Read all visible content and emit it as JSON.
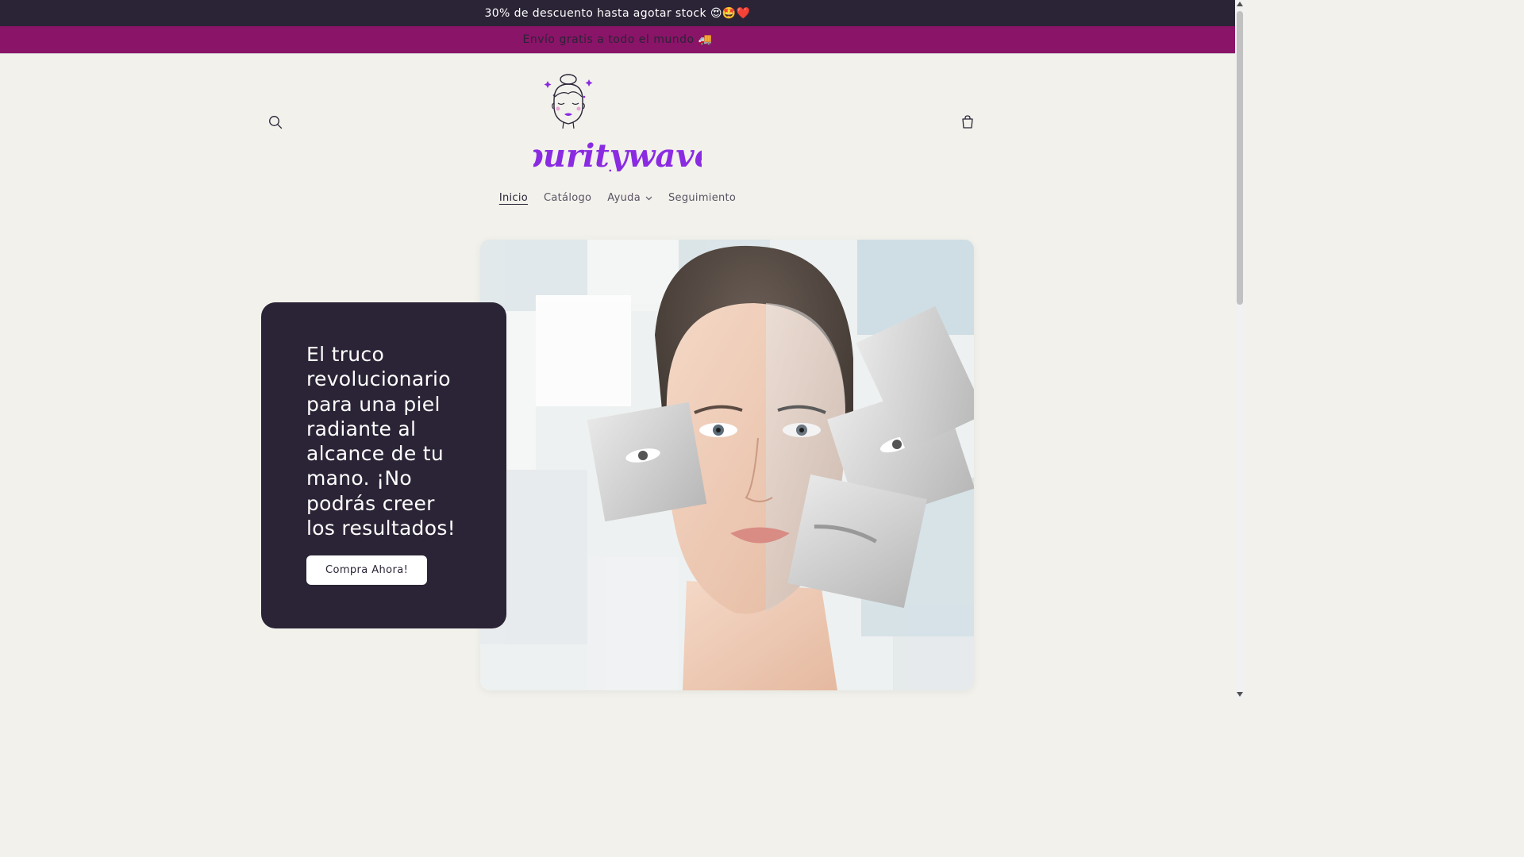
{
  "announcements": {
    "top": "30% de descuento hasta agotar stock 😍🤩❤️",
    "second": "Envío gratis a todo el mundo 🚚"
  },
  "header": {
    "logo_text": "puritywave",
    "icons": {
      "search": "search-icon",
      "cart": "cart-icon"
    }
  },
  "nav": {
    "items": [
      {
        "label": "Inicio"
      },
      {
        "label": "Catálogo"
      },
      {
        "label": "Ayuda"
      },
      {
        "label": "Seguimiento"
      }
    ]
  },
  "hero": {
    "title": "El truco revolucionario para una piel radiante al alcance de tu mano. ¡No podrás creer los resultados!",
    "cta_label": "Compra Ahora!"
  },
  "colors": {
    "dark": "#2b2436",
    "accent": "#8a1468",
    "logo": "#8a2be2",
    "background": "#f2f1ec"
  }
}
